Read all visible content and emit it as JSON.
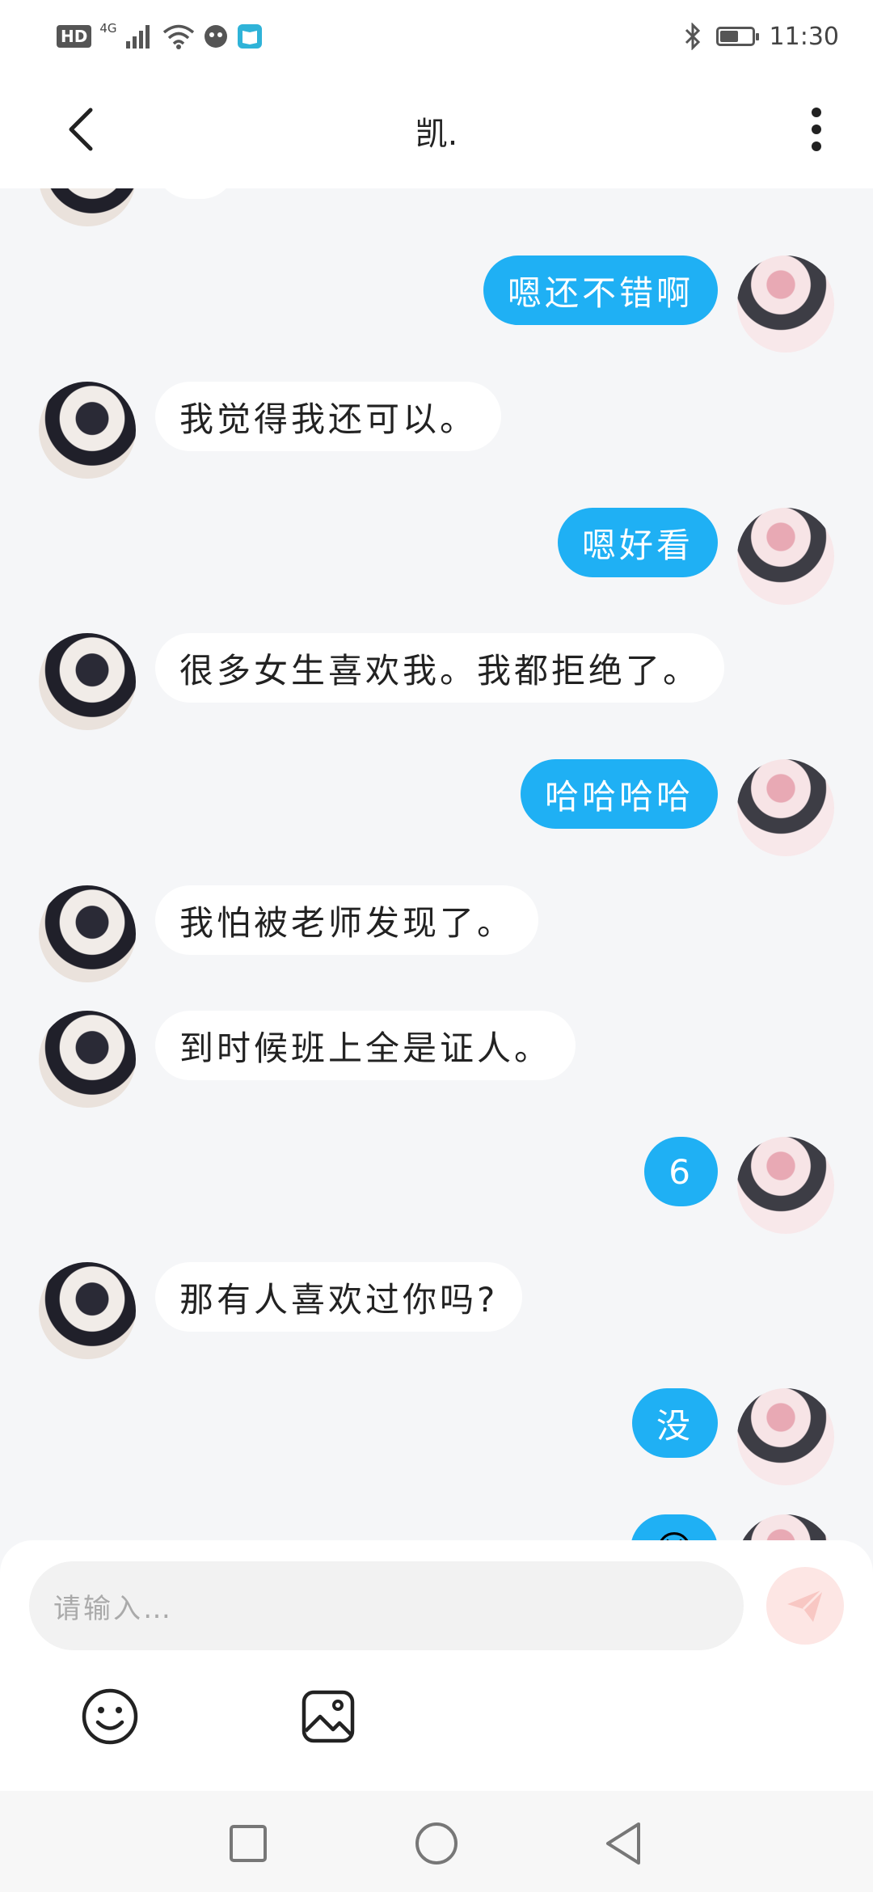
{
  "status_bar": {
    "hd": "HD",
    "network": "4G",
    "time": "11:30",
    "battery_level": 0.6,
    "icons": [
      "hd-badge",
      "signal-icon",
      "wifi-icon",
      "assistant-app-icon",
      "book-app-icon",
      "bluetooth-icon",
      "battery-icon"
    ]
  },
  "header": {
    "title": "凯.",
    "back_icon": "chevron-left-icon",
    "more_icon": "more-vertical-icon"
  },
  "messages": [
    {
      "side": "out",
      "text": "嗯还不错啊"
    },
    {
      "side": "in",
      "text": "我觉得我还可以。"
    },
    {
      "side": "out",
      "text": "嗯好看"
    },
    {
      "side": "in",
      "text": "很多女生喜欢我。我都拒绝了。"
    },
    {
      "side": "out",
      "text": "哈哈哈哈"
    },
    {
      "side": "in",
      "text": "我怕被老师发现了。"
    },
    {
      "side": "in",
      "text": "到时候班上全是证人。"
    },
    {
      "side": "out",
      "text": "6"
    },
    {
      "side": "in",
      "text": "那有人喜欢过你吗?"
    },
    {
      "side": "out",
      "text": "没"
    },
    {
      "side": "out",
      "text": "😆"
    }
  ],
  "composer": {
    "placeholder": "请输入…",
    "send_icon": "send-icon",
    "emoji_icon": "smiley-icon",
    "image_icon": "image-icon"
  },
  "navigation": {
    "icons": [
      "recent-apps-icon",
      "home-icon",
      "back-triangle-icon"
    ]
  },
  "colors": {
    "outgoing_bubble": "#1fb0f4",
    "incoming_bubble": "#ffffff",
    "chat_background": "#f5f6f8",
    "send_button": "#fde6e4"
  }
}
